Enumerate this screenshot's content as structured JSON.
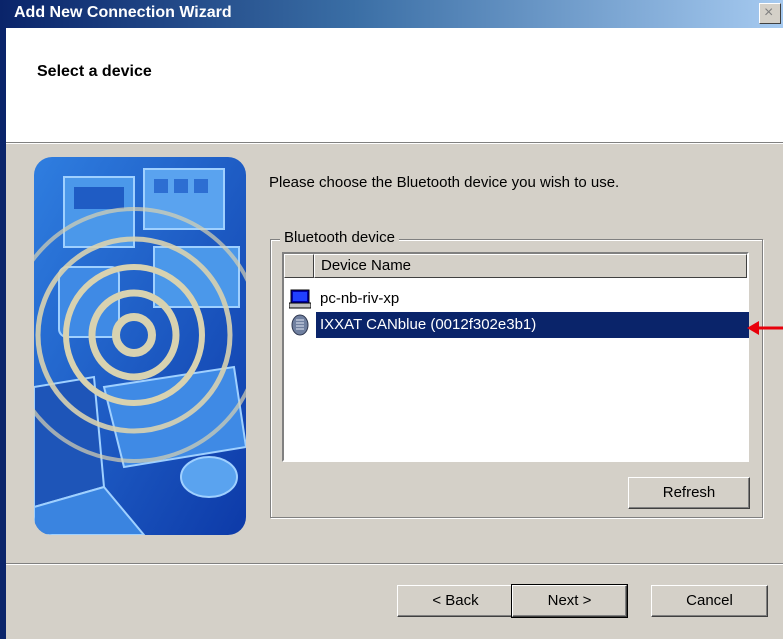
{
  "window": {
    "title": "Add New Connection Wizard",
    "close_label": "×"
  },
  "header": {
    "title": "Select a device"
  },
  "prompt": "Please choose the Bluetooth device you wish to use.",
  "group": {
    "label": "Bluetooth device",
    "column_header": "Device Name",
    "devices": [
      {
        "name": "pc-nb-riv-xp",
        "icon": "computer-icon",
        "selected": false
      },
      {
        "name": "IXXAT CANblue (0012f302e3b1)",
        "icon": "bluetooth-device-icon",
        "selected": true
      }
    ],
    "refresh_label": "Refresh"
  },
  "buttons": {
    "back": "< Back",
    "next": "Next >",
    "cancel": "Cancel"
  },
  "colors": {
    "selection": "#0a246a",
    "dialog_bg": "#d4d0c8",
    "arrow": "#e8000b"
  }
}
